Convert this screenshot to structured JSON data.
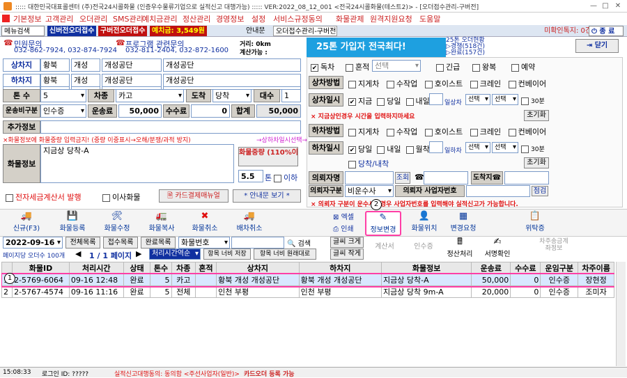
{
  "title": "::::: 대한민국대표콜센터 (주)전국24시콜화물 (인증우수물류기업으로 실적신고 대행가능) :::::  VER:2022_08_12_001  <전국24시콜화물(테스트2)> - [오더접수관리-구버전]",
  "menu": [
    "기본정보",
    "고객관리",
    "오더관리",
    "SMS관리",
    "예치금관리",
    "정산관리",
    "경영정보",
    "설정",
    "서비스규정동의",
    "화물관제",
    "원격지원요청",
    "도움말"
  ],
  "toolbar": {
    "menu_search": "메뉴검색",
    "new_order": "신버전오더접수",
    "old_order": "구버전오더접수",
    "deposit": "예치금: 3,549원",
    "guide": "안내문",
    "tab": "오더접수관리-구버전",
    "unsettled": "미확인톡지: 0건",
    "end": "종 료"
  },
  "contacts": {
    "civil_label": "민원문의",
    "civil_phones": "032-862-7924, 032-874-7924",
    "prog_label": "프로그램 관련문의",
    "prog_phones": "032-811-2404, 032-872-1600",
    "dist_label": "거리: 0km",
    "calc_label": "계산가능 :"
  },
  "banner": {
    "text": "25톤 가입자 전국최다!",
    "status1": "25톤 오더현황",
    "status2": "▷경쟁(518건)",
    "status3": "▷완료(157건)",
    "close": "닫기"
  },
  "form": {
    "load": {
      "label": "상차지",
      "a": "황북",
      "b": "개성",
      "c": "개성공단",
      "d": "개성공단"
    },
    "unload": {
      "label": "하차지",
      "a": "황북",
      "b": "개성",
      "c": "개성공단",
      "d": "개성공단"
    },
    "tons_label": "톤 수",
    "tons": "5",
    "cartype_label": "차종",
    "cartype": "카고",
    "arrive_label": "도착",
    "arrive": "당착",
    "count_label": "대수",
    "count": "1",
    "fee_type_label": "운송비구분",
    "fee_type": "인수증",
    "fare_label": "운송료",
    "fare": "50,000",
    "comm_label": "수수료",
    "comm": "0",
    "total_label": "합계",
    "total": "50,000",
    "extra_label": "추가정보",
    "warn1": "×화물정보에 화물중량 입력금지! (중량 이중표시→오해/분쟁/과적 방지)",
    "warn1b": "→상하차일시선택→",
    "cargo_label": "화물정보",
    "cargo": "지금상 당착-A",
    "weight_btn": "화물중량 (110%이하)",
    "weight": "5.5",
    "weight_unit": "톤",
    "below": "이하",
    "etax": "전자세금계산서 발행",
    "move": "이사화물",
    "card_btn": "카드결제매뉴얼",
    "guide_btn": "* 안내문 보기 *"
  },
  "right": {
    "solo": "독차",
    "mixed": "혼적",
    "select": "선택",
    "urgent": "긴급",
    "round": "왕복",
    "reserve": "예약",
    "load_method_label": "상차방법",
    "methods": [
      "지게차",
      "수작업",
      "호이스트",
      "크레인",
      "컨베이어"
    ],
    "load_time_label": "상차일시",
    "now": "지금",
    "today": "당일",
    "tomorrow": "내일",
    "sangcha": "일상차",
    "sel1": "선택",
    "sel2": "선택",
    "m30": "30분",
    "warn2": "× 지금상인경우 시간을 입력하지마세요",
    "reset": "초기화",
    "unload_method_label": "하차방법",
    "unload_time_label": "하차일시",
    "tmr": "내일",
    "weekend": "월착",
    "hacha": "일하차",
    "same": "당착/내착",
    "payer_label": "의뢰자명",
    "lookup": "조회",
    "arrive_tel": "도착지☎",
    "payer_type_label": "의뢰자구분",
    "payer_type": "비운수사",
    "payer_biz": "의뢰자 사업자번호",
    "check": "점검",
    "warn3": "× 의뢰자 구분이 운수사인경우 사업자번호를 입력해야 실적신고가 가능합니다."
  },
  "actions": {
    "new": "신규(F3)",
    "reg": "화물등록",
    "mod": "화물수정",
    "copy": "화물복사",
    "cancel": "화물취소",
    "dispatch_cancel": "배차취소",
    "excel": "엑셀",
    "print": "인쇄",
    "info_change": "정보변경",
    "location": "화물위치",
    "change_req": "변경요청",
    "consign": "위탁증"
  },
  "filter": {
    "date": "2022-09-16",
    "all": "전체목록",
    "recv": "접수목록",
    "done": "완료목록",
    "cargo_no": "화물번호",
    "search": "검색",
    "font_big": "글씨 크게",
    "font_small": "글씨 작게",
    "calc": "계산서",
    "receipt": "인수증",
    "settle": "정산처리",
    "sign": "서명확인",
    "car_payment": "차주송금계좌정보",
    "per_page": "페이지당 오더수 100개",
    "page": "1 / 1 페이지",
    "sort": "처리시간역순",
    "save_width": "항목 너비 저장",
    "reset_width": "항목 너비 원래대로"
  },
  "markers": [
    "1",
    "2"
  ],
  "grid": {
    "headers": [
      "",
      "화물ID",
      "처리시간",
      "상태",
      "톤수",
      "차종",
      "혼적",
      "상차지",
      "하차지",
      "화물정보",
      "운송료",
      "수수료",
      "운임구분",
      "차주이름"
    ],
    "rows": [
      [
        "1",
        "2-5769-6064",
        "09-16 12:48",
        "완료",
        "5",
        "카고",
        "",
        "황북 개성 개성공단",
        "황북 개성 개성공단",
        "지금상 당착-A",
        "50,000",
        "0",
        "인수증",
        "장현정"
      ],
      [
        "2",
        "2-5767-4574",
        "09-16 11:16",
        "완료",
        "5",
        "전체",
        "",
        "인천 부평",
        "인천 부평",
        "지금상 당착 9m-A",
        "20,000",
        "0",
        "인수증",
        "조미자"
      ]
    ]
  },
  "status": {
    "time": "15:08:33",
    "login": "로그인 ID: ?????",
    "msg": "실적신고대행동의: 동의함 <주선사업자(일반)>",
    "card": "카드오더 등록 가능"
  },
  "colors": {
    "accent": "#e01010",
    "highlight": "#ff3fa6",
    "title_blue": "#003399"
  }
}
